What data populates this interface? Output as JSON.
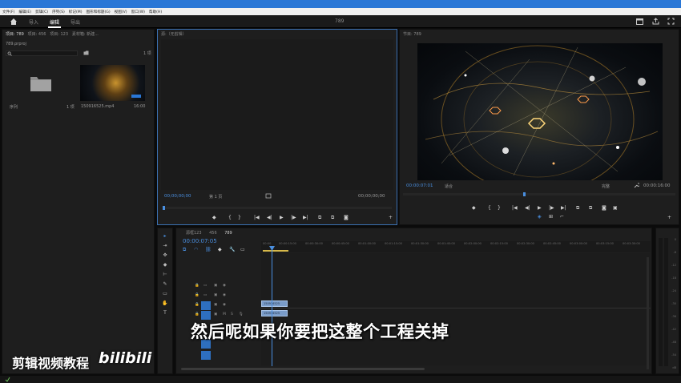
{
  "menu": [
    "文件(F)",
    "编辑(E)",
    "剪辑(C)",
    "序列(S)",
    "标记(M)",
    "图形和标题(G)",
    "视图(V)",
    "窗口(W)",
    "帮助(H)"
  ],
  "app": {
    "home_icon": "home-icon",
    "workspace_tabs": [
      "导入",
      "编辑",
      "导出"
    ],
    "active_tab": "编辑",
    "project_name": "789"
  },
  "project_panel": {
    "tabs": [
      "项目: 789",
      "项目: 456",
      "项目: 123",
      "素材箱: 新建..."
    ],
    "project_file": "789.prproj",
    "item_count": "1 项",
    "items": [
      {
        "name": "序列",
        "meta": "1 项"
      },
      {
        "name": "150916525.mp4",
        "meta": "16:00"
      }
    ]
  },
  "source_monitor": {
    "title": "源:（无剪辑）",
    "timecode_in": "00;00;00;00",
    "page": "第 1 页",
    "timecode_out": "00;00;00;00"
  },
  "program_monitor": {
    "title": "节目: 789",
    "timecode": "00:00:07:01",
    "fit": "适合",
    "quality": "完整",
    "duration": "00:00:16:00"
  },
  "timeline": {
    "tabs": [
      "源框123",
      "456",
      "789"
    ],
    "active_tab": "789",
    "timecode": "00:00:07:05",
    "ruler": [
      "00:00",
      "00:00:15:00",
      "00:00:30:00",
      "00:00:45:00",
      "00:01:00:00",
      "00:01:15:00",
      "00:01:30:00",
      "00:01:45:00",
      "00:02:00:00",
      "00:02:15:00",
      "00:02:30:00",
      "00:02:45:00",
      "00:03:00:00",
      "00:03:15:00",
      "00:03:30:00"
    ],
    "tracks": [
      {
        "name": "V3"
      },
      {
        "name": "V2"
      },
      {
        "name": "V1"
      },
      {
        "name": "A1"
      },
      {
        "name": "A2"
      },
      {
        "name": "A3"
      }
    ],
    "clip_video": "150916525",
    "clip_audio": "150916525"
  },
  "meter_ticks": [
    "0",
    "-6",
    "-12",
    "-18",
    "-24",
    "-30",
    "-36",
    "-42",
    "-48",
    "-54",
    "dB"
  ],
  "subtitle": "然后呢如果你要把这整个工程关掉",
  "watermark_text": "剪辑视频教程",
  "watermark_logo": "bilibili",
  "colors": {
    "accent": "#2a77d6",
    "clip": "#7a9cc9",
    "playhead": "#4a8fe0"
  }
}
